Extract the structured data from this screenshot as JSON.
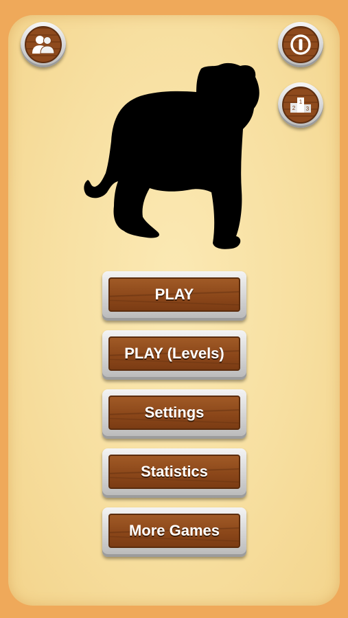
{
  "menu": {
    "buttons": [
      {
        "label": "PLAY"
      },
      {
        "label": "PLAY (Levels)"
      },
      {
        "label": "Settings"
      },
      {
        "label": "Statistics"
      },
      {
        "label": "More Games"
      }
    ]
  },
  "icons": {
    "top_left": "multiplayer-icon",
    "top_right": "info-icon",
    "right_second": "leaderboard-podium-icon"
  },
  "podium": {
    "first": "1",
    "second": "2",
    "third": "3"
  },
  "colors": {
    "background": "#efa95a",
    "panel": "#f7dfa0",
    "wood": "#8a4619",
    "button_text": "#ffffff"
  }
}
